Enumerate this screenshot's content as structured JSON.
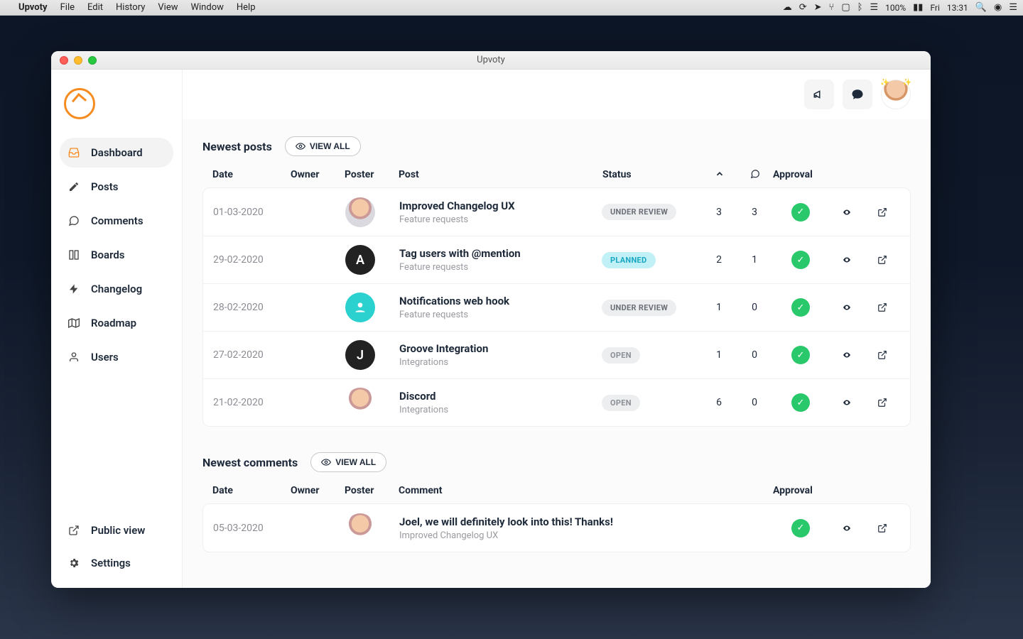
{
  "menubar": {
    "app": "Upvoty",
    "items": [
      "File",
      "Edit",
      "History",
      "View",
      "Window",
      "Help"
    ],
    "battery": "100%",
    "day": "Fri",
    "time": "13:31"
  },
  "window": {
    "title": "Upvoty"
  },
  "sidebar": {
    "items": [
      {
        "icon": "inbox-icon",
        "label": "Dashboard",
        "active": true
      },
      {
        "icon": "pencil-icon",
        "label": "Posts"
      },
      {
        "icon": "comment-icon",
        "label": "Comments"
      },
      {
        "icon": "boards-icon",
        "label": "Boards"
      },
      {
        "icon": "bolt-icon",
        "label": "Changelog"
      },
      {
        "icon": "map-icon",
        "label": "Roadmap"
      },
      {
        "icon": "user-icon",
        "label": "Users"
      }
    ],
    "bottom": [
      {
        "icon": "external-icon",
        "label": "Public view"
      },
      {
        "icon": "gear-icon",
        "label": "Settings"
      }
    ]
  },
  "main": {
    "newest_posts": {
      "title": "Newest posts",
      "view_all": "VIEW ALL",
      "columns": [
        "Date",
        "Owner",
        "Poster",
        "Post",
        "Status",
        "",
        "",
        "Approval",
        "",
        ""
      ],
      "col_date": "Date",
      "col_owner": "Owner",
      "col_poster": "Poster",
      "col_post": "Post",
      "col_status": "Status",
      "col_approval": "Approval",
      "rows": [
        {
          "date": "01-03-2020",
          "poster": {
            "type": "photo",
            "bg": "#d9d9df"
          },
          "title": "Improved Changelog UX",
          "sub": "Feature requests",
          "status": "UNDER REVIEW",
          "status_class": "status-review",
          "up": "3",
          "comments": "3"
        },
        {
          "date": "29-02-2020",
          "poster": {
            "type": "letter",
            "letter": "A",
            "bg": "#222"
          },
          "title": "Tag users with @mention",
          "sub": "Feature requests",
          "status": "PLANNED",
          "status_class": "status-planned",
          "up": "2",
          "comments": "1"
        },
        {
          "date": "28-02-2020",
          "poster": {
            "type": "icon",
            "bg": "#2bd1cf"
          },
          "title": "Notifications web hook",
          "sub": "Feature requests",
          "status": "UNDER REVIEW",
          "status_class": "status-review",
          "up": "1",
          "comments": "0"
        },
        {
          "date": "27-02-2020",
          "poster": {
            "type": "letter",
            "letter": "J",
            "bg": "#222"
          },
          "title": "Groove Integration",
          "sub": "Integrations",
          "status": "OPEN",
          "status_class": "status-open",
          "up": "1",
          "comments": "0"
        },
        {
          "date": "21-02-2020",
          "poster": {
            "type": "photo",
            "bg": "#fff"
          },
          "title": "Discord",
          "sub": "Integrations",
          "status": "OPEN",
          "status_class": "status-open",
          "up": "6",
          "comments": "0"
        }
      ]
    },
    "newest_comments": {
      "title": "Newest comments",
      "view_all": "VIEW ALL",
      "col_date": "Date",
      "col_owner": "Owner",
      "col_poster": "Poster",
      "col_comment": "Comment",
      "col_approval": "Approval",
      "rows": [
        {
          "date": "05-03-2020",
          "poster": {
            "type": "photo",
            "bg": "#fff"
          },
          "title": "Joel, we will definitely look into this! Thanks!",
          "sub": "Improved Changelog UX"
        }
      ]
    }
  }
}
